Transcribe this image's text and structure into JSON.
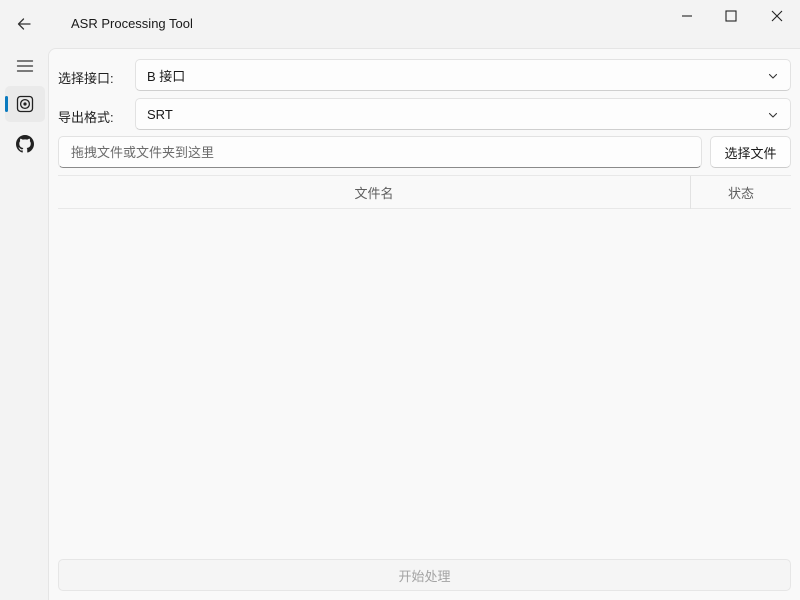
{
  "app": {
    "title": "ASR Processing Tool"
  },
  "titlebar": {
    "back_icon": "arrow-left-icon",
    "minimize_icon": "minimize-icon",
    "maximize_icon": "maximize-icon",
    "close_icon": "close-icon"
  },
  "nav": {
    "items": [
      {
        "icon": "hamburger-menu-icon",
        "selected": false
      },
      {
        "icon": "record-circle-icon",
        "selected": true
      },
      {
        "icon": "github-icon",
        "selected": false
      }
    ],
    "accent_color": "#0a7abf"
  },
  "form": {
    "interface_label": "选择接口:",
    "interface_value": "B 接口",
    "format_label": "导出格式:",
    "format_value": "SRT"
  },
  "drop": {
    "placeholder": "拖拽文件或文件夹到这里",
    "choose_button": "选择文件"
  },
  "table": {
    "columns": [
      "文件名",
      "状态"
    ],
    "rows": []
  },
  "actions": {
    "start_button": "开始处理",
    "start_enabled": false
  }
}
